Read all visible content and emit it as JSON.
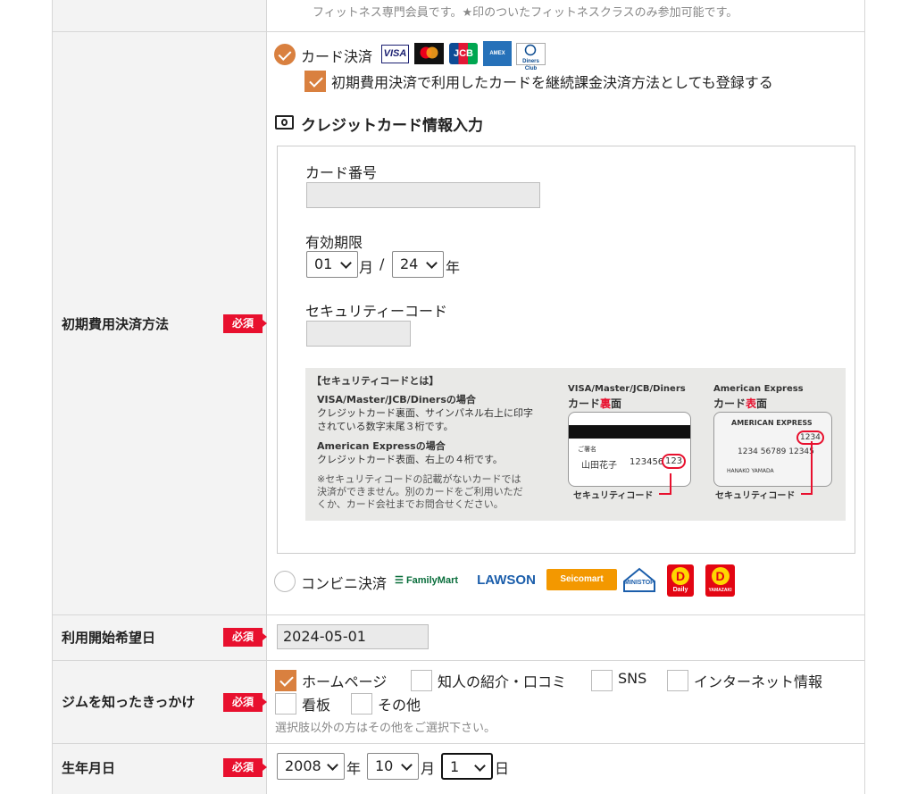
{
  "colors": {
    "accent": "#d9803f",
    "required": "#e8102e",
    "label_bg": "#f3f3f3"
  },
  "top_note": "フィットネス専門会員です。★印のついたフィットネスクラスのみ参加可能です。",
  "required_label": "必須",
  "payment": {
    "label": "初期費用決済方法",
    "card_option": {
      "label": "カード決済",
      "selected": true,
      "brands": [
        "VISA",
        "MasterCard",
        "JCB",
        "AMERICAN EXPRESS",
        "Diners Club"
      ]
    },
    "recurring_checkbox": {
      "label": "初期費用決済で利用したカードを継続課金決済方法としても登録する",
      "checked": true
    },
    "card_section_title": "クレジットカード情報入力",
    "card_number": {
      "label": "カード番号",
      "value": ""
    },
    "expiry": {
      "label": "有効期限",
      "month": "01",
      "month_unit": "月",
      "separator": "/",
      "year": "24",
      "year_unit": "年"
    },
    "security_code": {
      "label": "セキュリティーコード",
      "value": ""
    },
    "security_help": {
      "title": "【セキュリティコードとは】",
      "visa_head": "VISA/Master/JCB/Dinersの場合",
      "visa_body1": "クレジットカード裏面、サインパネル右上に印字",
      "visa_body2": "されている数字末尾３桁です。",
      "amex_head": "American Expressの場合",
      "amex_body": "クレジットカード表面、右上の４桁です。",
      "warn1": "※セキュリティコードの記載がないカードでは",
      "warn2": "決済ができません。別のカードをご利用いただ",
      "warn3": "くか、カード会社までお問合せください。",
      "card1_brand": "VISA/Master/JCB/Diners",
      "card1_side_a": "カード",
      "card1_side_b": "裏",
      "card1_side_c": "面",
      "card1_sign": "ご署名",
      "card1_name": "山田花子",
      "card1_num": "123456",
      "card1_code": "123",
      "card2_brand": "American Express",
      "card2_side_a": "カード",
      "card2_side_b": "表",
      "card2_side_c": "面",
      "card2_title": "AMERICAN EXPRESS",
      "card2_code": "1234",
      "card2_num": "1234 56789 12345",
      "card2_holder": "HANAKO YAMADA",
      "code_caption": "セキュリティコード"
    },
    "convenience_option": {
      "label": "コンビニ決済",
      "selected": false,
      "stores": [
        "FamilyMart",
        "LAWSON",
        "Seicomart",
        "MINISTOP",
        "Daily",
        "YAMAZAKI"
      ]
    }
  },
  "start_date": {
    "label": "利用開始希望日",
    "value": "2024-05-01"
  },
  "referral": {
    "label": "ジムを知ったきっかけ",
    "options": [
      {
        "label": "ホームページ",
        "checked": true
      },
      {
        "label": "知人の紹介・口コミ",
        "checked": false
      },
      {
        "label": "SNS",
        "checked": false
      },
      {
        "label": "インターネット情報",
        "checked": false
      },
      {
        "label": "看板",
        "checked": false
      },
      {
        "label": "その他",
        "checked": false
      }
    ],
    "note": "選択肢以外の方はその他をご選択下さい。"
  },
  "birthday": {
    "label": "生年月日",
    "year": "2008",
    "year_unit": "年",
    "month": "10",
    "month_unit": "月",
    "day": "1",
    "day_unit": "日"
  }
}
